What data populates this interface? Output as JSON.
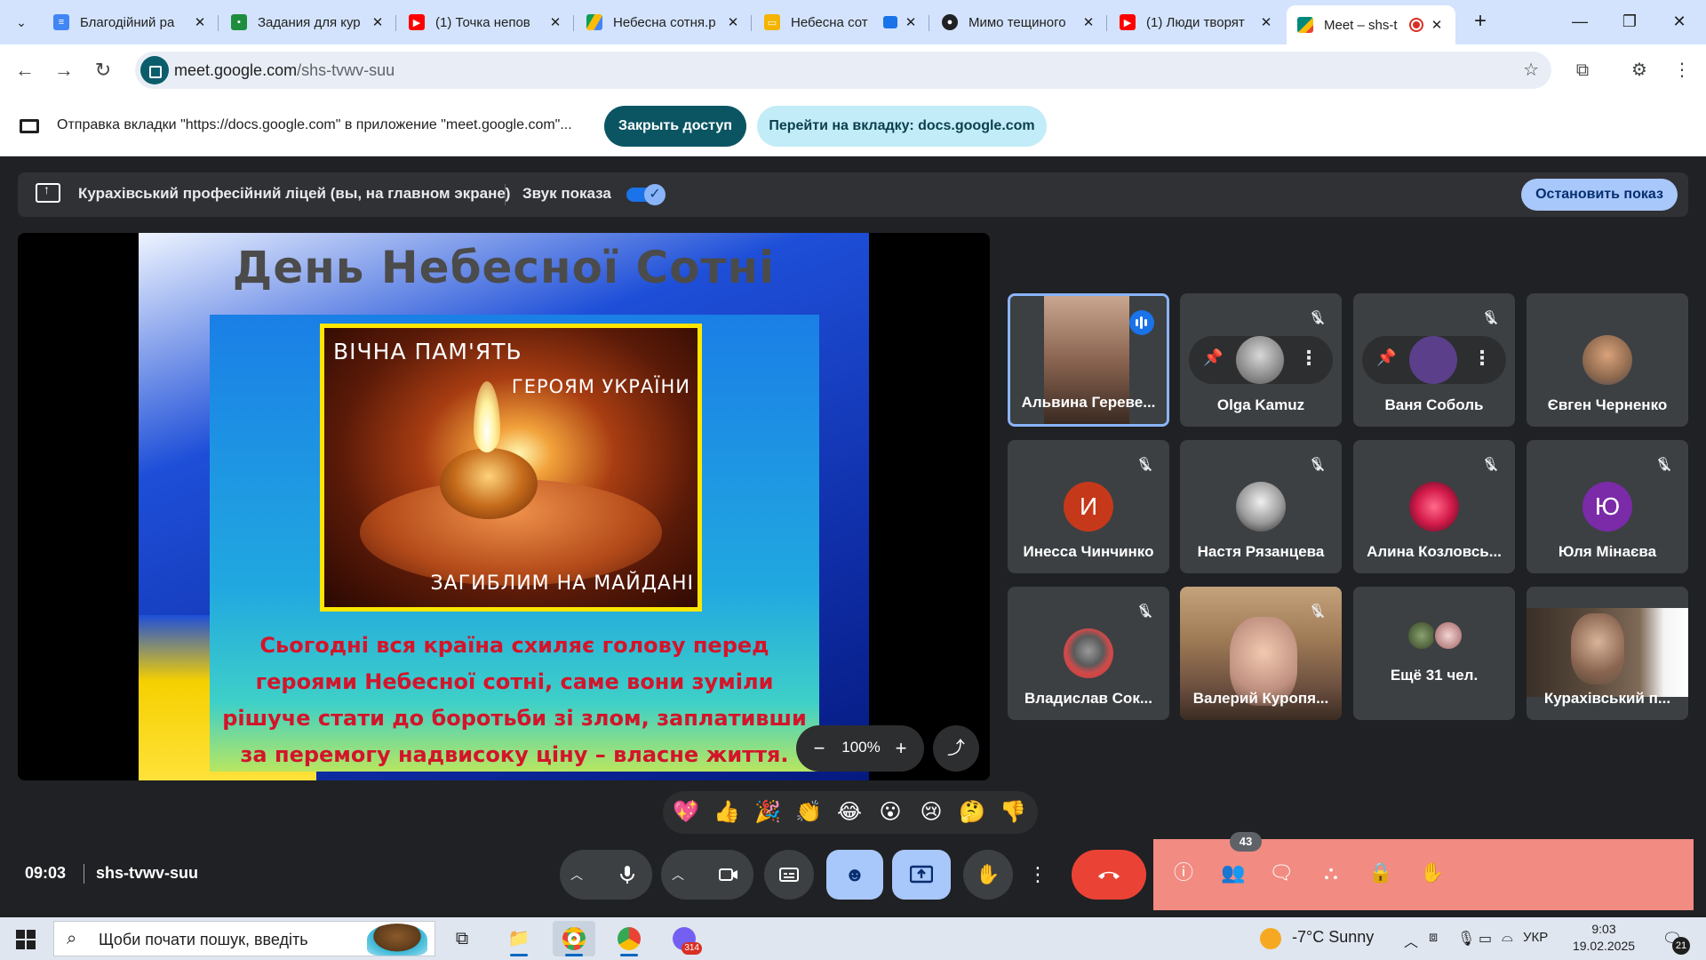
{
  "browser": {
    "tabs": [
      {
        "title": "Благодійний ра",
        "icon": "google-docs-icon",
        "color": "#4285f4"
      },
      {
        "title": "Задания для кур",
        "icon": "google-classroom-icon",
        "color": "#1e8e3e"
      },
      {
        "title": "(1) Точка непов",
        "icon": "youtube-icon",
        "color": "#ff0000"
      },
      {
        "title": "Небесна сотня.р",
        "icon": "google-drive-icon",
        "color": "#fbbc04"
      },
      {
        "title": "Небесна сот",
        "icon": "google-slides-icon",
        "color": "#f4b400"
      },
      {
        "title": "Мимо тещиного",
        "icon": "user-avatar-icon",
        "color": "#202124"
      },
      {
        "title": "(1) Люди творят",
        "icon": "youtube-icon",
        "color": "#ff0000"
      },
      {
        "title": "Meet – shs-t",
        "icon": "google-meet-icon",
        "color": "#00897b"
      }
    ],
    "url_host": "meet.google.com",
    "url_path": "/shs-tvwv-suu"
  },
  "infobar": {
    "text": "Отправка вкладки \"https://docs.google.com\" в приложение \"meet.google.com\"...",
    "close_access": "Закрыть доступ",
    "goto_tab": "Перейти на вкладку: docs.google.com"
  },
  "share_banner": {
    "title": "Кураxівський професійний ліцей (вы, на главном экране)",
    "sound_label": "Звук показа",
    "sound_on": true,
    "stop_label": "Остановить показ"
  },
  "slide": {
    "title": "День Небесної Сотні",
    "photo_line1": "ВІЧНА ПАМ'ЯТЬ",
    "photo_line2": "ГЕРОЯМ УКРАЇНИ",
    "photo_line3": "ЗАГИБЛИМ НА МАЙДАНІ",
    "text": "Сьогодні вся країна схиляє голову перед героями Небесної сотні, саме вони зуміли рішуче стати до боротьби зі злом, заплативши за перемогу надвисоку ціну – власне життя."
  },
  "zoom": {
    "value": "100%"
  },
  "participants": [
    {
      "name": "Альвина Гереве...",
      "type": "video",
      "speaking": true
    },
    {
      "name": "Olga Kamuz",
      "type": "hover",
      "muted": true
    },
    {
      "name": "Ваня Соболь",
      "type": "hover",
      "muted": true
    },
    {
      "name": "Євген Черненко",
      "type": "photo",
      "muted": false
    },
    {
      "name": "Инесса Чинчинко",
      "type": "letter",
      "letter": "И",
      "color": "#c5391a",
      "muted": true
    },
    {
      "name": "Настя Рязанцева",
      "type": "photo",
      "muted": true
    },
    {
      "name": "Алина Козловсь...",
      "type": "photo",
      "muted": true
    },
    {
      "name": "Юля Мінаєва",
      "type": "letter",
      "letter": "Ю",
      "color": "#7b2aa8",
      "muted": true
    },
    {
      "name": "Владислав Сок...",
      "type": "photo",
      "muted": true
    },
    {
      "name": "Валерий Куропя...",
      "type": "video",
      "muted": true
    },
    {
      "name": "Ещё 31 чел.",
      "type": "more"
    },
    {
      "name": "Кураxівський п...",
      "type": "video",
      "muted": false
    }
  ],
  "reactions": [
    "💖",
    "👍",
    "🎉",
    "👏",
    "😂",
    "😮",
    "😢",
    "🤔",
    "👎"
  ],
  "meeting": {
    "time": "09:03",
    "code": "shs-tvwv-suu",
    "participants_count": "43"
  },
  "taskbar": {
    "search_placeholder": "Щоби почати пошук, введіть",
    "weather": "-7°C  Sunny",
    "lang": "УКР",
    "time": "9:03",
    "date": "19.02.2025",
    "notifications": "21",
    "viber_badge": "314"
  }
}
